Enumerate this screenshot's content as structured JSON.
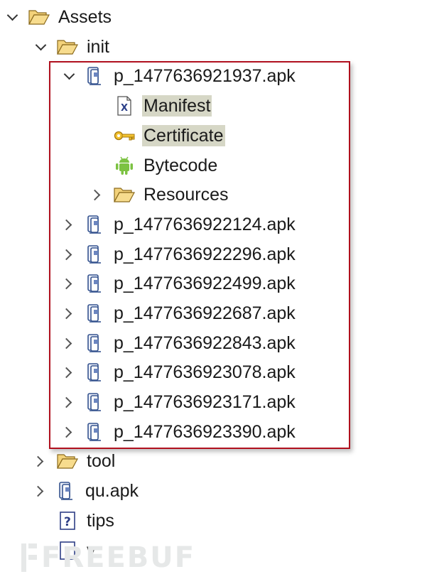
{
  "tree": {
    "assets": {
      "label": "Assets"
    },
    "init": {
      "label": "init"
    },
    "apk_open": {
      "label": "p_1477636921937.apk",
      "children": {
        "manifest": "Manifest",
        "certificate": "Certificate",
        "bytecode": "Bytecode",
        "resources": "Resources"
      }
    },
    "apks": [
      "p_1477636922124.apk",
      "p_1477636922296.apk",
      "p_1477636922499.apk",
      "p_1477636922687.apk",
      "p_1477636922843.apk",
      "p_1477636923078.apk",
      "p_1477636923171.apk",
      "p_1477636923390.apk"
    ],
    "tool": "tool",
    "qu_apk": "qu.apk",
    "tips": "tips",
    "v": "v"
  },
  "watermark": "FREEBUF",
  "colors": {
    "highlight_border": "#b0101e",
    "selection_bg": "#d6d7c6",
    "folder": "#e8b84a",
    "android": "#7cc242"
  },
  "icons": {
    "folder": "folder-icon",
    "apk": "apk-archive-icon",
    "manifest": "xml-file-icon",
    "certificate": "key-icon",
    "bytecode": "android-icon",
    "unknown": "unknown-file-icon"
  }
}
